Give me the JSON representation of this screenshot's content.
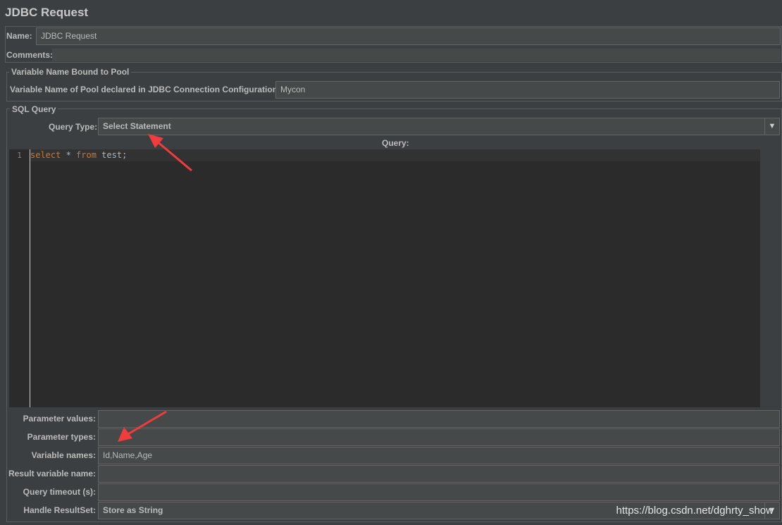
{
  "window": {
    "title": "JDBC Request"
  },
  "name": {
    "label": "Name:",
    "value": "JDBC Request"
  },
  "comments": {
    "label": "Comments:",
    "value": ""
  },
  "pool": {
    "legend": "Variable Name Bound to Pool",
    "label": "Variable Name of Pool declared in JDBC Connection Configuration:",
    "value": "Mycon"
  },
  "sql": {
    "legend": "SQL Query",
    "query_type_label": "Query Type:",
    "query_type_value": "Select Statement",
    "query_header": "Query:",
    "editor": {
      "line_number": "1",
      "tokens": [
        {
          "text": "select",
          "kw": true
        },
        {
          "text": " * ",
          "kw": false
        },
        {
          "text": "from",
          "kw": true
        },
        {
          "text": " test;",
          "kw": false
        }
      ]
    }
  },
  "params": [
    {
      "label": "Parameter values:",
      "value": ""
    },
    {
      "label": "Parameter types:",
      "value": ""
    },
    {
      "label": "Variable names:",
      "value": "Id,Name,Age"
    },
    {
      "label": "Result variable name:",
      "value": ""
    },
    {
      "label": "Query timeout (s):",
      "value": ""
    }
  ],
  "resultset": {
    "label": "Handle ResultSet:",
    "value": "Store as String"
  },
  "dropdown_icon": "triangle-down",
  "watermark": "https://blog.csdn.net/dghrty_show",
  "colors": {
    "background": "#3c3f41",
    "field": "#45494a",
    "editor": "#2b2b2b",
    "keyword": "#cc7832",
    "annotation_arrow": "#f03c3c"
  }
}
